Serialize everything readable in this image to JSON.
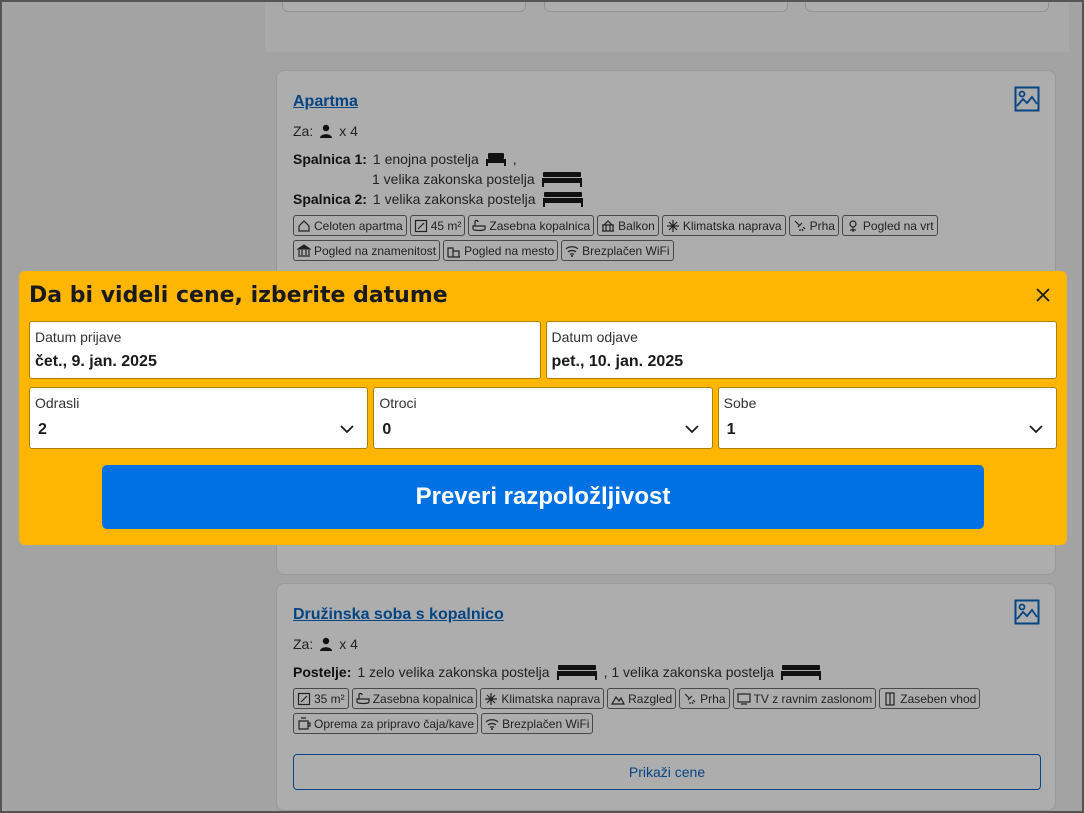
{
  "rooms": [
    {
      "title": "Apartma",
      "za_label": "Za:",
      "occupancy": "x 4",
      "bedrooms": [
        {
          "label": "Spalnica 1:",
          "beds": [
            "1 enojna postelja",
            "1 velika zakonska postelja"
          ]
        },
        {
          "label": "Spalnica 2:",
          "beds": [
            "1 velika zakonska postelja"
          ]
        }
      ],
      "tags": [
        {
          "icon": "house-icon",
          "text": "Celoten apartma"
        },
        {
          "icon": "area-icon",
          "text": "45 m²"
        },
        {
          "icon": "bathtub-icon",
          "text": "Zasebna kopalnica"
        },
        {
          "icon": "balcony-icon",
          "text": "Balkon"
        },
        {
          "icon": "snowflake-icon",
          "text": "Klimatska naprava"
        },
        {
          "icon": "shower-icon",
          "text": "Prha"
        },
        {
          "icon": "flower-icon",
          "text": "Pogled na vrt"
        },
        {
          "icon": "landmark-icon",
          "text": "Pogled na znamenitost"
        },
        {
          "icon": "city-icon",
          "text": "Pogled na mesto"
        },
        {
          "icon": "wifi-icon",
          "text": "Brezplačen WiFi"
        }
      ]
    },
    {
      "title": "Družinska soba s kopalnico",
      "za_label": "Za:",
      "occupancy": "x 4",
      "beds_label": "Postelje:",
      "beds_text_1": "1 zelo velika zakonska postelja",
      "beds_text_2": ", 1 velika zakonska postelja",
      "tags": [
        {
          "icon": "area-icon",
          "text": "35 m²"
        },
        {
          "icon": "bathtub-icon",
          "text": "Zasebna kopalnica"
        },
        {
          "icon": "snowflake-icon",
          "text": "Klimatska naprava"
        },
        {
          "icon": "mountain-icon",
          "text": "Razgled"
        },
        {
          "icon": "shower-icon",
          "text": "Prha"
        },
        {
          "icon": "tv-icon",
          "text": "TV z ravnim zaslonom"
        },
        {
          "icon": "door-icon",
          "text": "Zaseben vhod"
        },
        {
          "icon": "kettle-icon",
          "text": "Oprema za pripravo čaja/kave"
        },
        {
          "icon": "wifi-icon",
          "text": "Brezplačen WiFi"
        }
      ],
      "prices_button": "Prikaži cene"
    }
  ],
  "modal": {
    "title": "Da bi videli cene, izberite datume",
    "checkin_label": "Datum prijave",
    "checkin_value": "čet., 9. jan. 2025",
    "checkout_label": "Datum odjave",
    "checkout_value": "pet., 10. jan. 2025",
    "adults_label": "Odrasli",
    "adults_value": "2",
    "children_label": "Otroci",
    "children_value": "0",
    "rooms_label": "Sobe",
    "rooms_value": "1",
    "submit_label": "Preveri razpoložljivost"
  },
  "colors": {
    "modal_bg": "#feb602",
    "primary_button": "#0071e2",
    "link": "#0a66c2"
  }
}
